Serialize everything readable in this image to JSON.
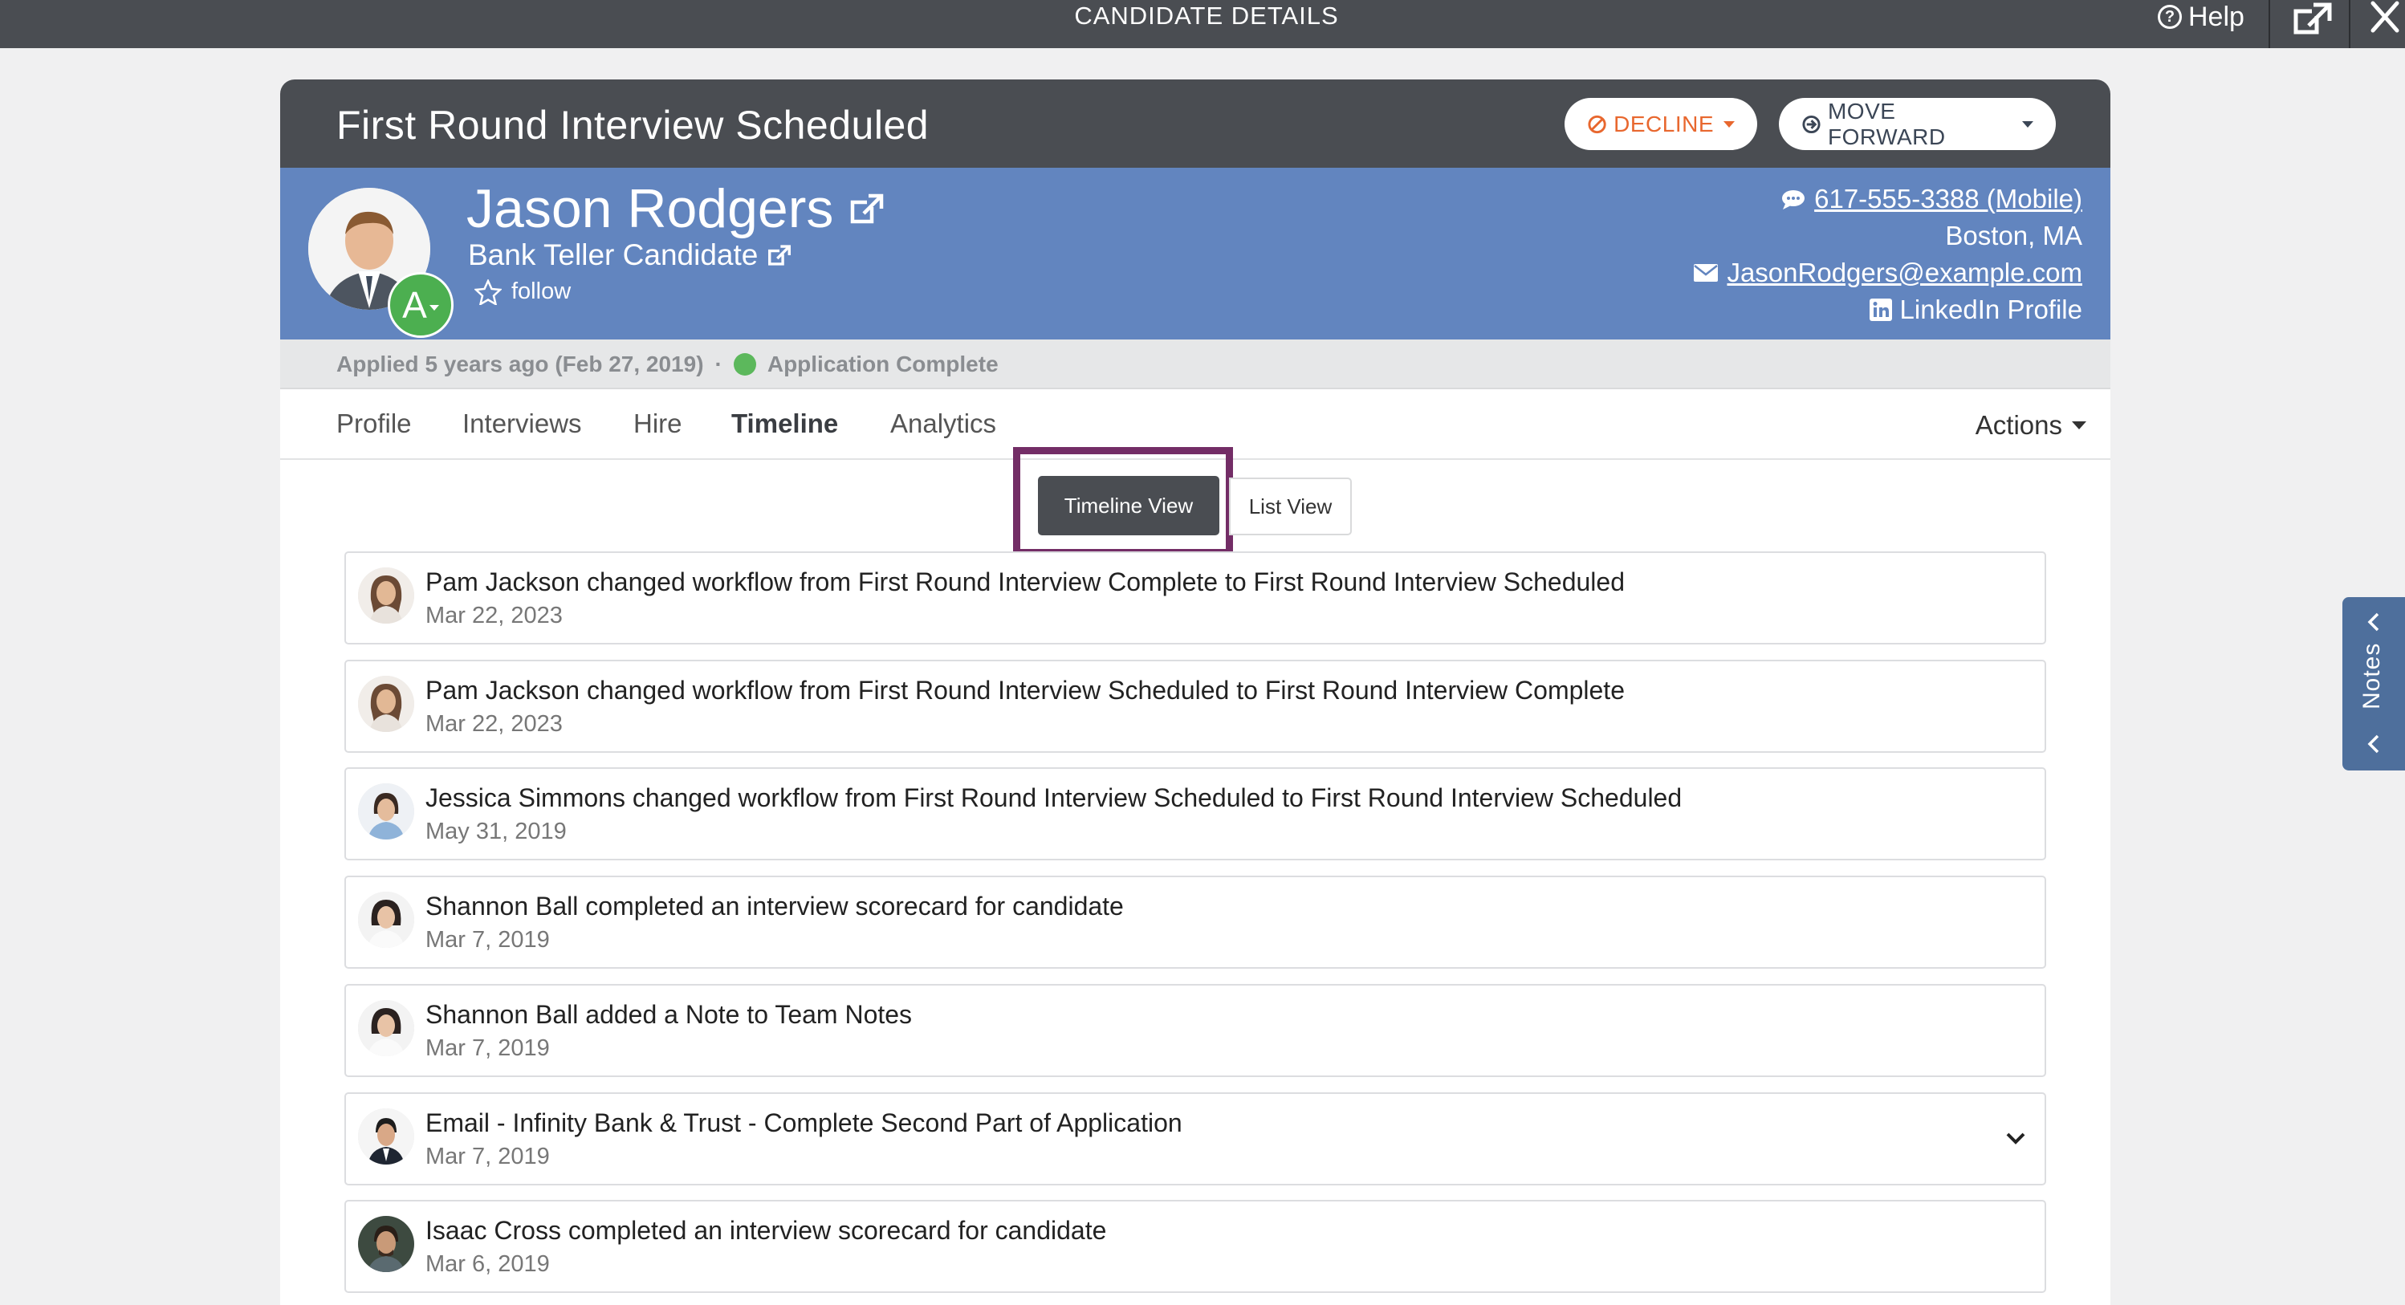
{
  "topbar": {
    "title": "CANDIDATE DETAILS",
    "help_label": "Help",
    "help_icon": "?",
    "external_icon": "external-link-icon",
    "close_icon": "close-icon"
  },
  "header": {
    "workflow_status": "First Round Interview Scheduled",
    "decline_label": "DECLINE",
    "move_forward_label": "MOVE FORWARD",
    "colors": {
      "header_bg": "#4a4d52",
      "decline": "#e8672e",
      "profile_bg": "#6285bf"
    }
  },
  "candidate": {
    "name": "Jason Rodgers",
    "job": "Bank Teller Candidate",
    "follow_label": "follow",
    "grade": "A",
    "phone": "617-555-3388 (Mobile)",
    "location": "Boston, MA",
    "email": "JasonRodgers@example.com",
    "linkedin": "LinkedIn Profile"
  },
  "application": {
    "applied": "Applied 5 years ago (Feb 27, 2019)",
    "separator": "·",
    "status": "Application Complete",
    "status_color": "#5cb85c"
  },
  "tabs": [
    {
      "label": "Profile"
    },
    {
      "label": "Interviews"
    },
    {
      "label": "Hire"
    },
    {
      "label": "Timeline",
      "active": true
    },
    {
      "label": "Analytics"
    }
  ],
  "actions_label": "Actions",
  "view_toggle": {
    "timeline_label": "Timeline View",
    "list_label": "List View",
    "selected": "Timeline View",
    "highlight_color": "#732d66"
  },
  "timeline": [
    {
      "title": "Pam Jackson changed workflow from First Round Interview Complete to First Round Interview Scheduled",
      "date": "Mar 22, 2023"
    },
    {
      "title": "Pam Jackson changed workflow from First Round Interview Scheduled to First Round Interview Complete",
      "date": "Mar 22, 2023"
    },
    {
      "title": "Jessica Simmons changed workflow from First Round Interview Scheduled to First Round Interview Scheduled",
      "date": "May 31, 2019"
    },
    {
      "title": "Shannon Ball completed an interview scorecard for candidate",
      "date": "Mar 7, 2019"
    },
    {
      "title": "Shannon Ball added a Note to Team Notes",
      "date": "Mar 7, 2019"
    },
    {
      "title": "Email - Infinity Bank & Trust - Complete Second Part of Application",
      "date": "Mar 7, 2019",
      "expandable": true
    },
    {
      "title": "Isaac Cross completed an interview scorecard for candidate",
      "date": "Mar 6, 2019"
    }
  ],
  "notes_tab_label": "Notes"
}
